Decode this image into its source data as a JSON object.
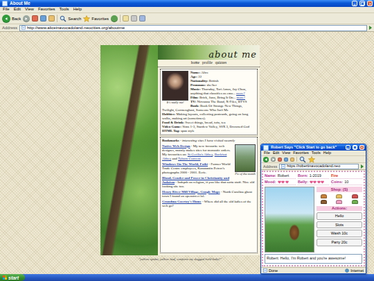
{
  "window": {
    "title": "About Me",
    "menu": [
      "File",
      "Edit",
      "View",
      "Favorites",
      "Tools",
      "Help"
    ],
    "toolbar": [
      {
        "label": "Back",
        "kind": "back"
      },
      {
        "label": "Search",
        "kind": "search"
      },
      {
        "label": "Favorites",
        "kind": "favorites"
      }
    ],
    "address_label": "Address",
    "url": "http://www.aliceinavocadoland.neocities.org/aboutme"
  },
  "page": {
    "heading": "about me",
    "nav": [
      "home",
      "profile",
      "quizzes"
    ],
    "profile": {
      "photo_caption": "It's really me!",
      "fields": [
        {
          "label": "Name:",
          "value": "Alice",
          "more": ""
        },
        {
          "label": "Age:",
          "value": "22",
          "more": ""
        },
        {
          "label": "Nationality:",
          "value": "British",
          "more": ""
        },
        {
          "label": "Pronouns:",
          "value": "she/her",
          "more": ""
        },
        {
          "label": "Music:",
          "value": "Thursday, Tori Amos, Jay Chou, anything that classifies as emo...",
          "more": "more?"
        },
        {
          "label": "Film:",
          "value": "Brick, Juno, Bring It On...",
          "more": "more?"
        },
        {
          "label": "TV:",
          "value": "Nirvanna The Band, X-Files, BTVS",
          "more": ""
        },
        {
          "label": "Book:",
          "value": "Book Of Strange New Things, Twilight, Gormenghast, Someone Who Isn't Me",
          "more": ""
        },
        {
          "label": "Hobbies:",
          "value": "Making layouts, collecting postcards, going on long walks, making art (sometimes).",
          "more": ""
        },
        {
          "label": "Food & Drink:",
          "value": "Sweet things, bread, tofu, tea",
          "more": ""
        },
        {
          "label": "Video Game:",
          "value": "Sims 1-3, Stardew Valley, SSX 3, Drowned God",
          "more": ""
        },
        {
          "label": "HTML Tag:",
          "value": "span style",
          "more": ""
        }
      ]
    },
    "bookmarks": {
      "title": "Bookmarks",
      "subtitle": " - interesting sites I have visited recently",
      "pic_caption": "Pic of the month",
      "entries": [
        {
          "parts": [
            {
              "text": "Native Web Design",
              "link": true
            },
            {
              "text": " - My new favourite web designer, mainly makes sites for monastic orders. My favourites are ",
              "link": false
            },
            {
              "text": "St Cecilia's Abbey",
              "link": true
            },
            {
              "text": ", ",
              "link": false
            },
            {
              "text": "Buckfast Abbey",
              "link": true
            },
            {
              "text": " and ",
              "link": false
            },
            {
              "text": "Tyburn Convent",
              "link": true
            }
          ]
        },
        {
          "parts": [
            {
              "text": "Windows On The World, Fotki",
              "link": true
            },
            {
              "text": " - Former World Trade Centre employees, Konstantin Petrov's photographs 2000 - 2001. Eerie.",
              "link": false
            }
          ]
        },
        {
          "parts": [
            {
              "text": "Blood, Gender and Power in Christianity and Judaism",
              "link": true
            },
            {
              "text": " - Indepth on religion, if you like that sorta stuff. Nice old looking site too.",
              "link": false
            }
          ]
        },
        {
          "parts": [
            {
              "text": "Henry River Mill Village, Google Maps",
              "link": true
            },
            {
              "text": " - North Carolina ghost town I found on openstreet lol.",
              "link": false
            }
          ]
        },
        {
          "parts": [
            {
              "text": "Grandma Goertzy's Home",
              "link": true
            },
            {
              "text": " - Where did all the old ladies of the web go?",
              "link": false
            }
          ]
        }
      ]
    },
    "footer": "\"yellow spider, yellow leaf, conform my dogged hold baby!\""
  },
  "popup": {
    "title": "Robert Says \"Click Start to go back\"",
    "menu": [
      "File",
      "Edit",
      "View",
      "Favorites",
      "Tools",
      "Help"
    ],
    "address_label": "Address",
    "url": "https://robertinavocadoland.neo",
    "stats": [
      {
        "kind": "text",
        "label": "Name:",
        "value": "Robert"
      },
      {
        "kind": "text",
        "label": "Born:",
        "value": "1-2019"
      },
      {
        "kind": "tag",
        "value": "Fire"
      },
      {
        "kind": "hearts",
        "label": "Mood:",
        "hearts": 3
      },
      {
        "kind": "hearts",
        "label": "Belly:",
        "hearts": 4
      },
      {
        "kind": "text",
        "label": "Coins:",
        "value": "10"
      }
    ],
    "shop": {
      "title": "Shop: (S)",
      "items": [
        {
          "color": "#c8813a"
        },
        {
          "color": "#e8c060"
        },
        {
          "color": "#d05050"
        },
        {
          "color": "#8a5a30"
        },
        {
          "color": "#f0a0c0"
        },
        {
          "color": "#70b050"
        }
      ]
    },
    "actions": {
      "title": "Actions:",
      "buttons": [
        "Hello",
        "Slots",
        "Wash 10c",
        "Party 20c"
      ]
    },
    "message": "Robert: Hello, I'm Robert and you're awesome!",
    "status": {
      "left": "Done",
      "right": "Internet"
    }
  },
  "taskbar": {
    "start": "start"
  }
}
